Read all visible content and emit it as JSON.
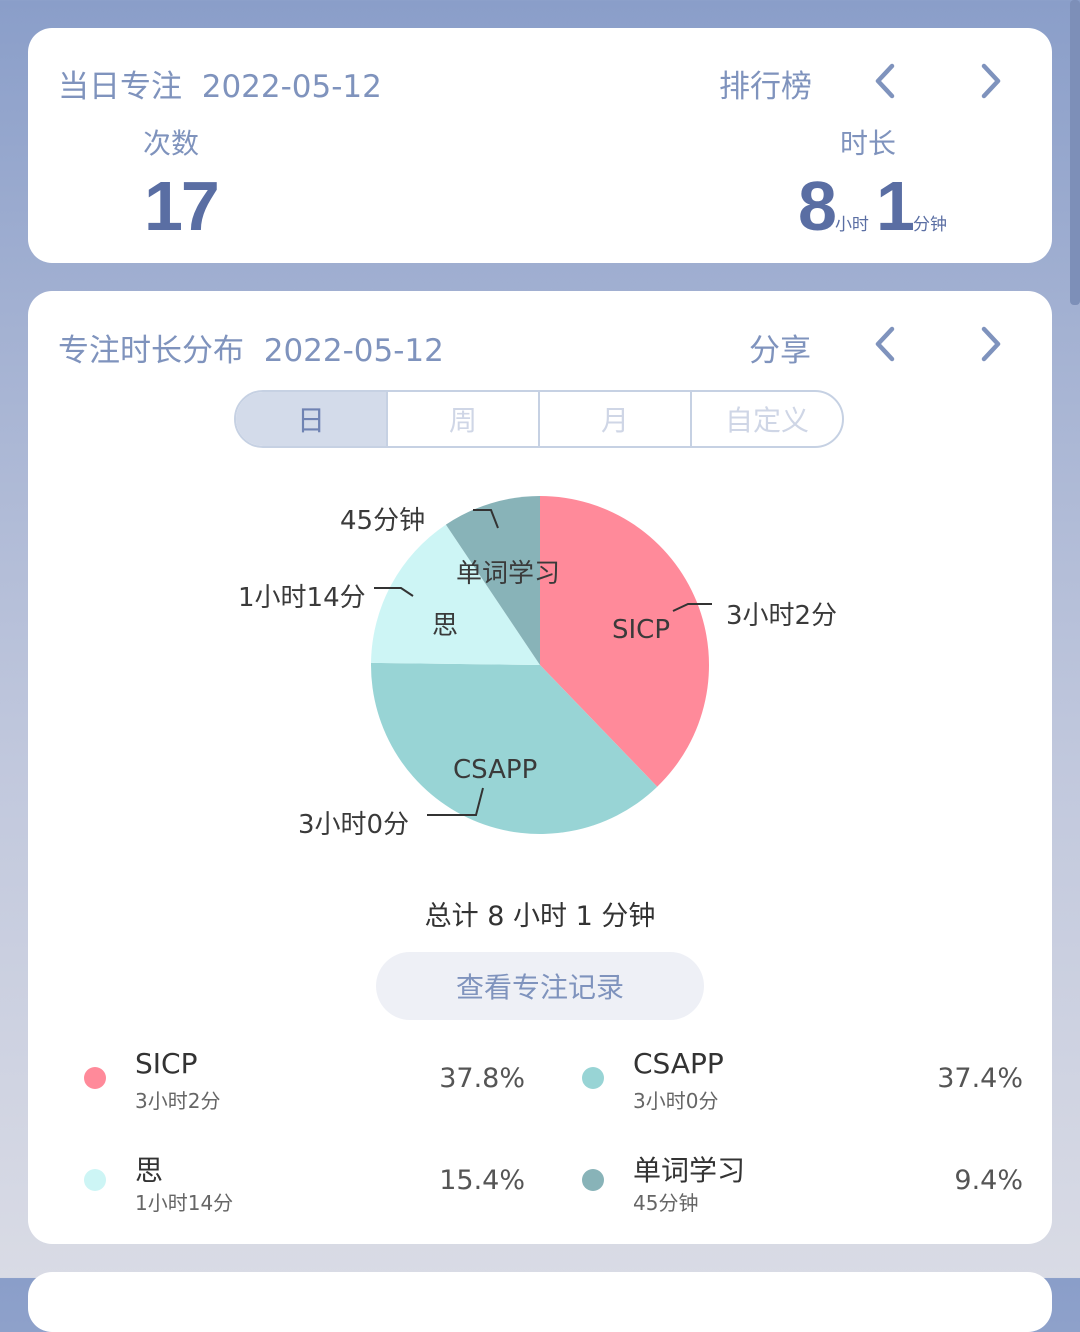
{
  "daily": {
    "title": "当日专注",
    "date": "2022-05-12",
    "ranking_label": "排行榜",
    "count_label": "次数",
    "count_value": "17",
    "duration_label": "时长",
    "hours_value": "8",
    "hours_unit": "小时",
    "minutes_value": "1",
    "minutes_unit": "分钟"
  },
  "distribution": {
    "title": "专注时长分布",
    "date": "2022-05-12",
    "share_label": "分享",
    "tabs": [
      {
        "label": "日",
        "active": true
      },
      {
        "label": "周",
        "active": false
      },
      {
        "label": "月",
        "active": false
      },
      {
        "label": "自定义",
        "active": false
      }
    ],
    "total_text": "总计 8 小时 1 分钟",
    "record_button": "查看专注记录"
  },
  "chart_data": {
    "type": "pie",
    "slices": [
      {
        "name": "SICP",
        "value": 37.8,
        "duration": "3小时2分",
        "color": "#ff8a9a"
      },
      {
        "name": "CSAPP",
        "value": 37.4,
        "duration": "3小时0分",
        "color": "#98d4d5"
      },
      {
        "name": "思",
        "value": 15.4,
        "duration": "1小时14分",
        "color": "#cdf5f5"
      },
      {
        "name": "单词学习",
        "value": 9.4,
        "duration": "45分钟",
        "color": "#88b3b8"
      }
    ]
  },
  "legend": [
    {
      "name": "SICP",
      "sub": "3小时2分",
      "pct": "37.8%",
      "color": "#ff8a9a"
    },
    {
      "name": "CSAPP",
      "sub": "3小时0分",
      "pct": "37.4%",
      "color": "#98d4d5"
    },
    {
      "name": "思",
      "sub": "1小时14分",
      "pct": "15.4%",
      "color": "#cdf5f5"
    },
    {
      "name": "单词学习",
      "sub": "45分钟",
      "pct": "9.4%",
      "color": "#88b3b8"
    }
  ],
  "pie_labels": {
    "sicp_outer": "3小时2分",
    "csapp_outer": "3小时0分",
    "si_outer": "1小时14分",
    "word_outer": "45分钟",
    "sicp_inner": "SICP",
    "csapp_inner": "CSAPP",
    "si_inner": "思",
    "word_inner": "单词学习"
  },
  "icons": {
    "prev": "chevron-left-icon",
    "next": "chevron-right-icon"
  }
}
